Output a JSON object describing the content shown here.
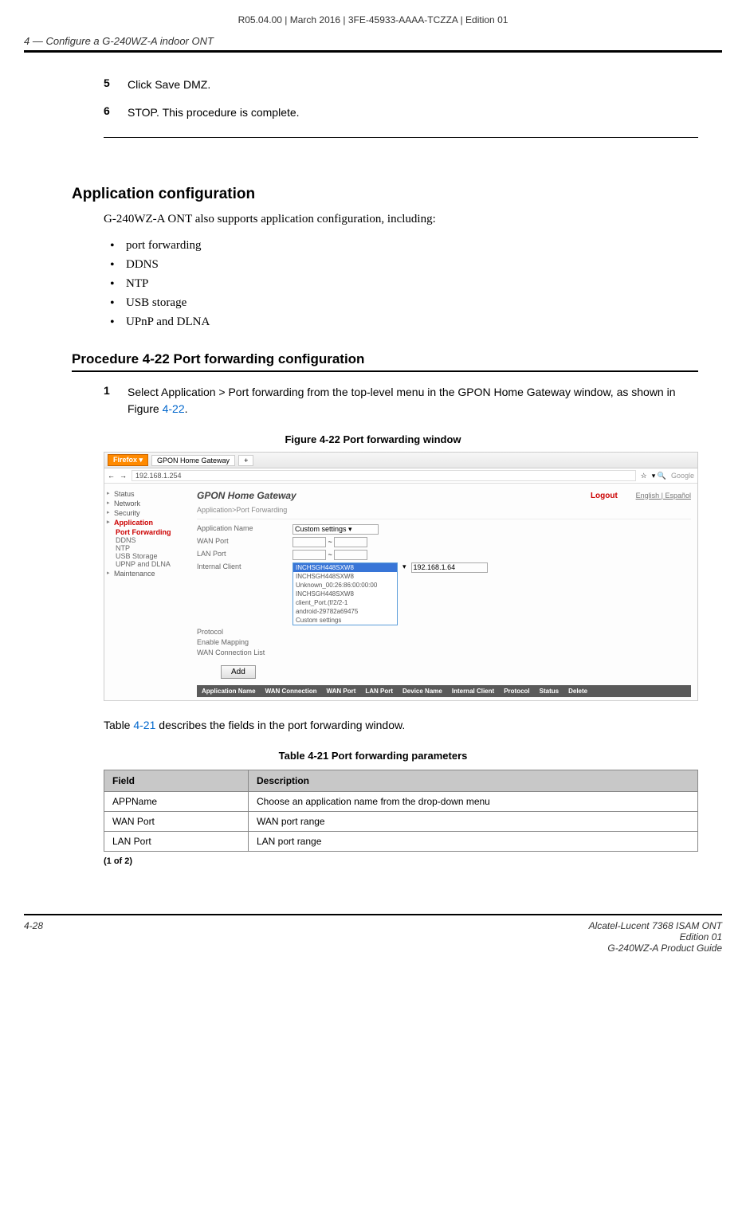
{
  "doc_header": "R05.04.00 | March 2016 | 3FE-45933-AAAA-TCZZA | Edition 01",
  "section_header": "4 —  Configure a G-240WZ-A indoor ONT",
  "steps": [
    {
      "num": "5",
      "text": "Click Save DMZ."
    },
    {
      "num": "6",
      "text": "STOP. This procedure is complete."
    }
  ],
  "h2": "Application configuration",
  "intro": "G-240WZ-A ONT also supports application configuration, including:",
  "bullets": [
    "port forwarding",
    "DDNS",
    "NTP",
    "USB storage",
    "UPnP and DLNA"
  ],
  "h3": "Procedure 4-22  Port forwarding configuration",
  "proc_step": {
    "num": "1",
    "text_before": "Select Application > Port forwarding from the top-level menu in the GPON Home Gateway window, as shown in Figure ",
    "link": "4-22",
    "text_after": "."
  },
  "figure_caption": "Figure 4-22  Port forwarding window",
  "figure": {
    "browser_tab_ff": "Firefox ▾",
    "browser_tab": "GPON Home Gateway",
    "browser_tab_plus": "+",
    "url": "192.168.1.254",
    "search_placeholder": "Google",
    "banner_title": "GPON Home Gateway",
    "logout": "Logout",
    "lang": "English | Español",
    "breadcrumb": "Application>Port Forwarding",
    "sidebar": {
      "status": "Status",
      "network": "Network",
      "security": "Security",
      "application": "Application",
      "subs": [
        "Port Forwarding",
        "DDNS",
        "NTP",
        "USB Storage",
        "UPNP and DLNA"
      ],
      "maintenance": "Maintenance"
    },
    "form": {
      "app_name_label": "Application Name",
      "app_name_value": "Custom settings",
      "wan_port_label": "WAN Port",
      "lan_port_label": "LAN Port",
      "internal_client_label": "Internal Client",
      "internal_ip": "192.168.1.64",
      "protocol_label": "Protocol",
      "enable_label": "Enable Mapping",
      "wan_conn_label": "WAN Connection List",
      "dropdown": {
        "selected": "INCHSGH448SXW8",
        "options": [
          "INCHSGH448SXW8",
          "Unknown_00:26:86:00:00:00",
          "INCHSGH448SXW8",
          "client_Port.(f/2/2-1",
          "android-29782a69475",
          "Custom settings"
        ]
      },
      "add_btn": "Add"
    },
    "table_cols": [
      "Application Name",
      "WAN Connection",
      "WAN Port",
      "LAN Port",
      "Device Name",
      "Internal Client",
      "Protocol",
      "Status",
      "Delete"
    ]
  },
  "table_intro_before": "Table ",
  "table_intro_link": "4-21",
  "table_intro_after": " describes the fields in the port forwarding window.",
  "table_caption": "Table 4-21 Port forwarding parameters",
  "table": {
    "headers": [
      "Field",
      "Description"
    ],
    "rows": [
      [
        "APPName",
        "Choose an application name from the drop-down menu"
      ],
      [
        "WAN Port",
        "WAN port range"
      ],
      [
        "LAN Port",
        "LAN port range"
      ]
    ]
  },
  "table_continuation": "(1 of 2)",
  "footer": {
    "page_num": "4-28",
    "line1": "Alcatel-Lucent 7368 ISAM ONT",
    "line2": "Edition 01",
    "line3": "G-240WZ-A Product Guide"
  }
}
